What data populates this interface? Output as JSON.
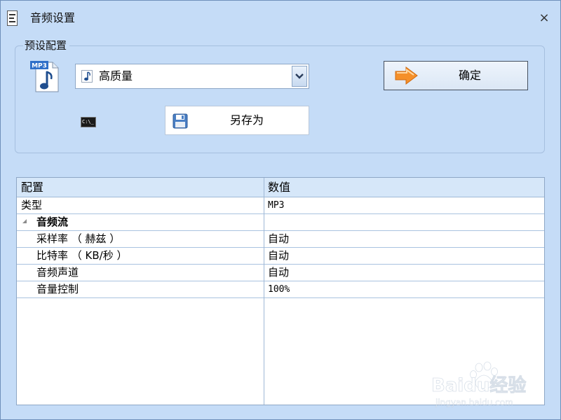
{
  "window": {
    "title": "音频设置",
    "close_glyph": "×"
  },
  "preset": {
    "group_label": "预设配置",
    "selected": "高质量",
    "confirm_label": "确定",
    "save_as_label": "另存为",
    "mp3_icon_text": "MP3",
    "cmd_icon_text": "C:\\_"
  },
  "grid": {
    "headers": [
      "配置",
      "数值"
    ],
    "rows": [
      {
        "name": "类型",
        "value": "MP3"
      },
      {
        "category": "音频流"
      },
      {
        "name": "采样率 （ 赫兹 ）",
        "value": "自动"
      },
      {
        "name": "比特率 （ KB/秒 ）",
        "value": "自动"
      },
      {
        "name": "音频声道",
        "value": "自动"
      },
      {
        "name": "音量控制",
        "value": "100%"
      }
    ]
  },
  "watermark": {
    "brand": "Baidu经验",
    "url": "jingyan.baidu.com"
  },
  "colors": {
    "window_bg": "#c5dcf7",
    "grid_header_bg": "#d6e7f9",
    "grid_line": "#a9c2e0",
    "accent_orange": "#f5902a"
  },
  "icons": {
    "app": "music-score-icon",
    "close": "close-icon",
    "mp3": "mp3-file-icon",
    "note": "music-note-icon",
    "dropdown": "chevron-down-icon",
    "confirm": "arrow-right-icon",
    "cmd": "console-icon",
    "save": "floppy-disk-icon",
    "expand": "expand-triangle-icon"
  }
}
